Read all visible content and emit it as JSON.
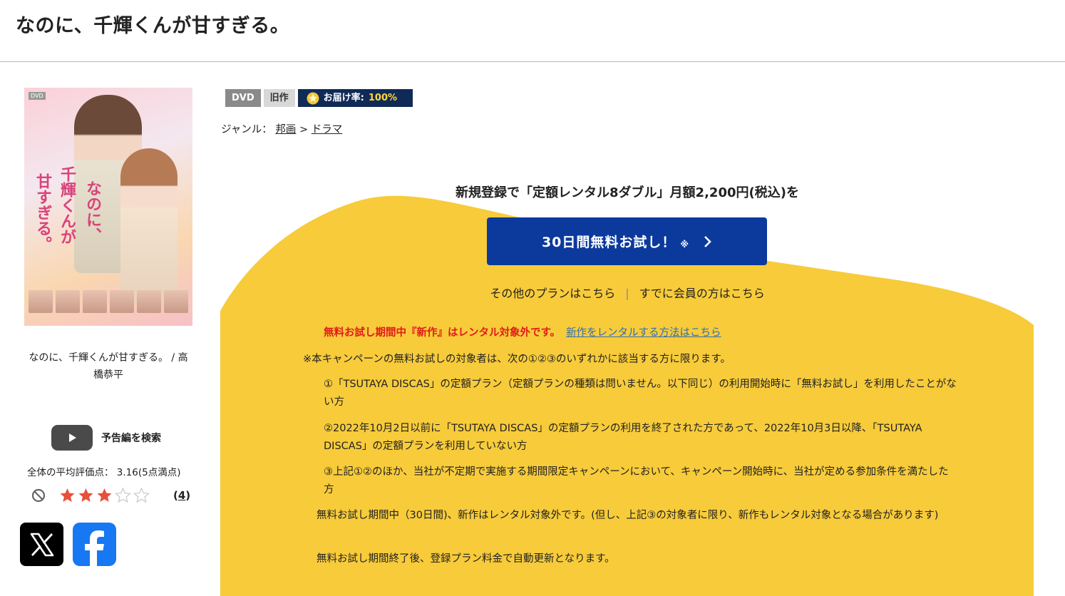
{
  "page": {
    "title": "なのに、千輝くんが甘すぎる。"
  },
  "product": {
    "cover_text": {
      "line1": "甘すぎる。",
      "line2": "千輝くんが",
      "line3": "なのに、"
    },
    "caption": "なのに、千輝くんが甘すぎる。 / 高橋恭平",
    "trailer_label": "予告編を検索",
    "avg_rating_text": "全体の平均評価点： 3.16(5点満点)",
    "rating": {
      "value": 3.16,
      "max": 5,
      "stars_filled": 3
    },
    "review_count": "4",
    "share": {
      "x_icon": "x-logo-icon",
      "facebook_icon": "facebook-logo-icon"
    }
  },
  "badges": {
    "format": "DVD",
    "status": "旧作",
    "delivery_label": "お届け率:",
    "delivery_rate": "100%"
  },
  "genre": {
    "label": "ジャンル：",
    "items": [
      "邦画",
      "ドラマ"
    ],
    "separator": ">"
  },
  "campaign": {
    "headline": "新規登録で「定額レンタル8ダブル」月額2,200円(税込)を",
    "cta_label": "30日間無料お試し！",
    "cta_note": "※",
    "other_plans": "その他のプランはこちら",
    "separator": "|",
    "members": "すでに会員の方はこちら",
    "warning": "無料お試し期間中『新作』はレンタル対象外です。",
    "warning_link": "新作をレンタルする方法はこちら",
    "conditions_intro": "※本キャンペーンの無料お試しの対象者は、次の①②③のいずれかに該当する方に限ります。",
    "conditions": [
      "①「TSUTAYA DISCAS」の定額プラン（定額プランの種類は問いません。以下同じ）の利用開始時に「無料お試し」を利用したことがない方",
      "②2022年10月2日以前に「TSUTAYA DISCAS」の定額プランの利用を終了された方であって、2022年10月3日以降、「TSUTAYA DISCAS」の定額プランを利用していない方",
      "③上記①②のほか、当社が不定期で実施する期間限定キャンペーンにおいて、キャンペーン開始時に、当社が定める参加条件を満たした方"
    ],
    "notes": [
      "無料お試し期間中（30日間)、新作はレンタル対象外です。(但し、上記③の対象者に限り、新作もレンタル対象となる場合があります)",
      "無料お試し期間終了後、登録プラン料金で自動更新となります。"
    ]
  },
  "colors": {
    "accent_yellow": "#f7cb3a",
    "cta_blue": "#0b3a9c",
    "warning_red": "#e21a1a",
    "badge_navy": "#0f2a57"
  }
}
